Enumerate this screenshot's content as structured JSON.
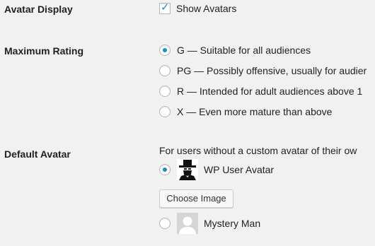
{
  "avatar_display": {
    "label": "Avatar Display",
    "checkbox_label": "Show Avatars",
    "checked": true
  },
  "maximum_rating": {
    "label": "Maximum Rating",
    "options": [
      {
        "text": "G — Suitable for all audiences",
        "checked": true
      },
      {
        "text": "PG — Possibly offensive, usually for audier",
        "checked": false
      },
      {
        "text": "R — Intended for adult audiences above 1",
        "checked": false
      },
      {
        "text": "X — Even more mature than above",
        "checked": false
      }
    ]
  },
  "default_avatar": {
    "label": "Default Avatar",
    "description": "For users without a custom avatar of their ow",
    "options": [
      {
        "text": "WP User Avatar",
        "checked": true,
        "icon": "wp-user-avatar-icon"
      },
      {
        "text": "Mystery Man",
        "checked": false,
        "icon": "mystery-man-icon"
      }
    ],
    "choose_image_label": "Choose Image"
  },
  "colors": {
    "background": "#f1f1f1",
    "accent": "#1e8cbe",
    "text": "#222222"
  }
}
